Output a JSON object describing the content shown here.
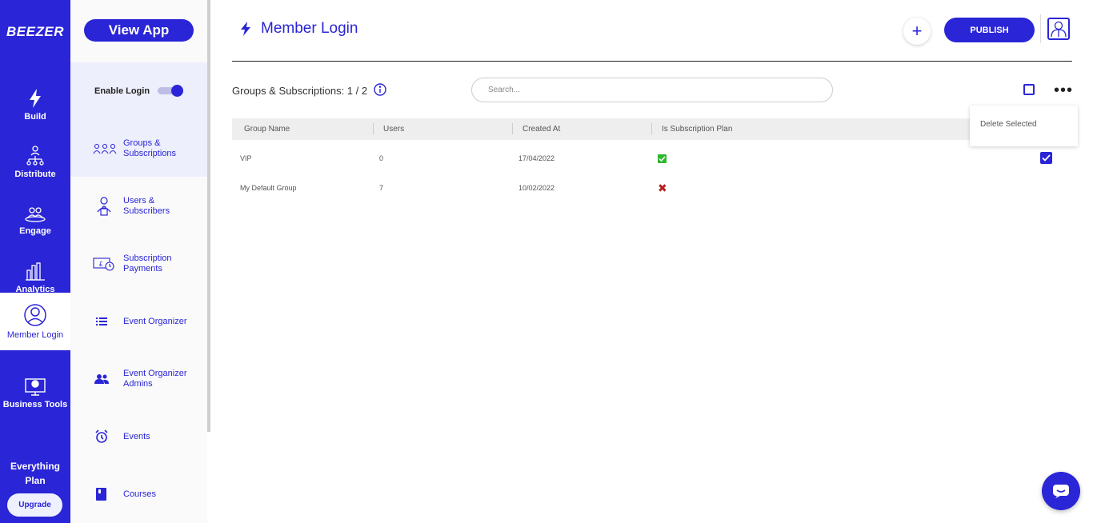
{
  "brand": {
    "logo": "BEEZER",
    "accent": "#2a25d6"
  },
  "rail": {
    "items": [
      {
        "label": "Build",
        "icon": "lightning-icon"
      },
      {
        "label": "Distribute",
        "icon": "distribute-icon"
      },
      {
        "label": "Engage",
        "icon": "engage-icon"
      },
      {
        "label": "Analytics",
        "icon": "analytics-icon"
      },
      {
        "label": "Member Login",
        "icon": "member-login-icon",
        "active": true
      },
      {
        "label": "Business Tools",
        "icon": "business-tools-icon"
      }
    ],
    "plan_label": "Everything Plan",
    "upgrade_label": "Upgrade"
  },
  "subnav": {
    "view_app_label": "View App",
    "enable_login_label": "Enable Login",
    "enable_login_on": true,
    "items": [
      {
        "label": "Groups & Subscriptions",
        "icon": "groups-icon",
        "active": true
      },
      {
        "label": "Users & Subscribers",
        "icon": "users-lock-icon"
      },
      {
        "label": "Subscription Payments",
        "icon": "payments-icon"
      },
      {
        "label": "Event Organizer",
        "icon": "list-icon"
      },
      {
        "label": "Event Organizer Admins",
        "icon": "people-icon"
      },
      {
        "label": "Events",
        "icon": "alarm-icon"
      },
      {
        "label": "Courses",
        "icon": "book-icon"
      }
    ]
  },
  "header": {
    "title": "Member Login",
    "publish_label": "PUBLISH"
  },
  "toolbar": {
    "count_text": "Groups & Subscriptions: 1 / 2",
    "search_placeholder": "Search..."
  },
  "dropdown": {
    "options": [
      "Delete Selected"
    ]
  },
  "table": {
    "columns": [
      "Group Name",
      "Users",
      "Created At",
      "Is Subscription Plan"
    ],
    "rows": [
      {
        "name": "VIP",
        "users": "0",
        "created": "17/04/2022",
        "is_plan": true,
        "selected": true
      },
      {
        "name": "My Default Group",
        "users": "7",
        "created": "10/02/2022",
        "is_plan": false,
        "selected": false
      }
    ]
  }
}
